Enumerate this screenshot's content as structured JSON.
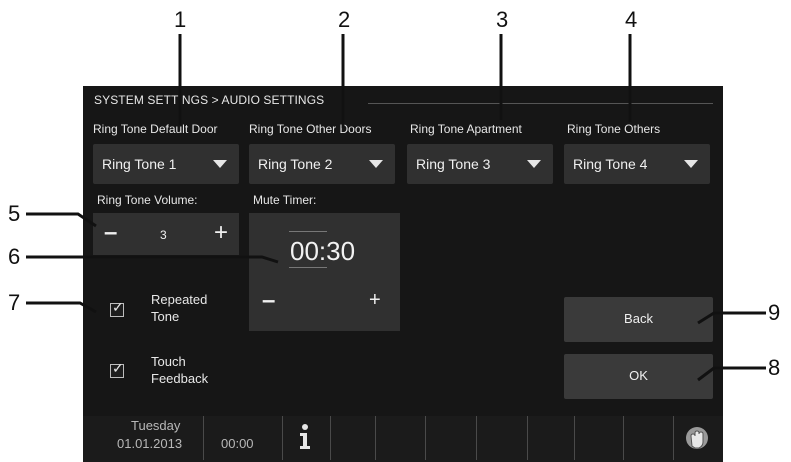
{
  "callouts": [
    "1",
    "2",
    "3",
    "4",
    "5",
    "6",
    "7",
    "8",
    "9"
  ],
  "header": {
    "breadcrumb": "SYSTEM SETTINGS > AUDIO SETTINGS"
  },
  "ringtones": [
    {
      "label": "Ring Tone Default Door",
      "value": "Ring Tone 1"
    },
    {
      "label": "Ring Tone Other Doors",
      "value": "Ring Tone 2"
    },
    {
      "label": "Ring Tone Apartment",
      "value": "Ring Tone 3"
    },
    {
      "label": "Ring Tone Others",
      "value": "Ring Tone 4"
    }
  ],
  "volume": {
    "label": "Ring Tone Volume:",
    "minus": "–",
    "value": "3",
    "plus": "+"
  },
  "mute_timer": {
    "label": "Mute Timer:",
    "value": "00:30",
    "minus": "–",
    "plus": "+"
  },
  "options": [
    {
      "label_line1": "Repeated",
      "label_line2": "Tone",
      "checked": true
    },
    {
      "label_line1": "Touch",
      "label_line2": "Feedback",
      "checked": true
    }
  ],
  "buttons": {
    "back": "Back",
    "ok": "OK"
  },
  "status_bar": {
    "day": "Tuesday",
    "date": "01.01.2013",
    "time": "00:00",
    "info_icon": "info-icon",
    "touch_icon": "hand-icon"
  },
  "icons": {
    "dropdown": "triangle-down-icon",
    "checkbox": "checkbox-checked-icon"
  }
}
